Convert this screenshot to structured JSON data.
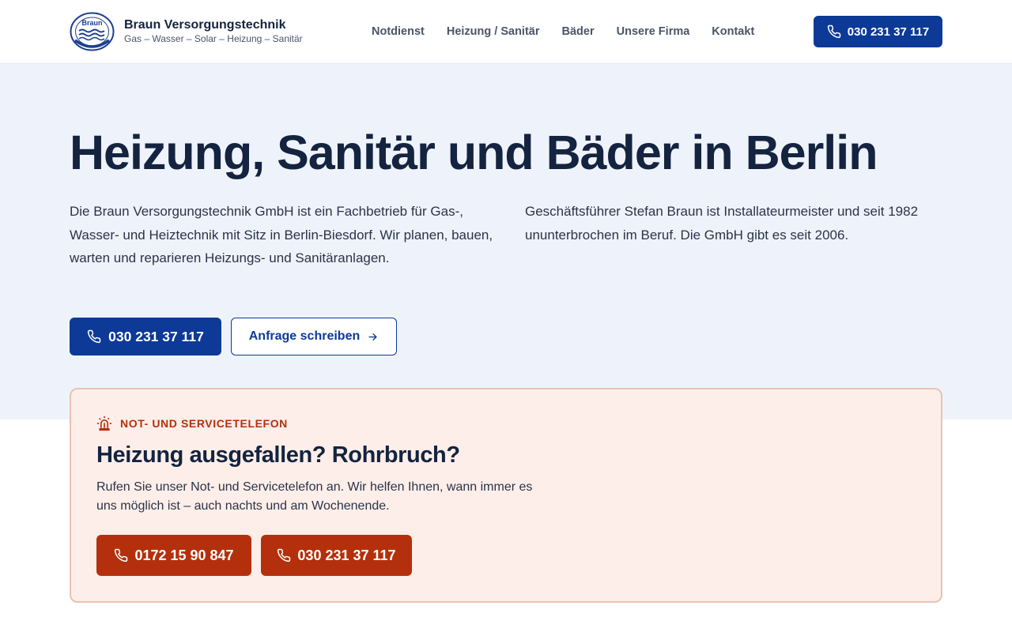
{
  "header": {
    "brand_name": "Braun Versorgungstechnik",
    "brand_tagline": "Gas – Wasser – Solar – Heizung – Sanitär",
    "logo_text": "Braun",
    "nav": [
      {
        "label": "Notdienst"
      },
      {
        "label": "Heizung / Sanitär"
      },
      {
        "label": "Bäder"
      },
      {
        "label": "Unsere Firma"
      },
      {
        "label": "Kontakt"
      }
    ],
    "call_button": "030 231 37 117"
  },
  "hero": {
    "title": "Heizung, Sanitär und Bäder in Berlin",
    "paragraph_left": "Die Braun Versorgungstechnik GmbH ist ein Fachbetrieb für Gas-, Wasser- und Heiztechnik mit Sitz in Berlin-Biesdorf. Wir planen, bauen, warten und reparieren Heizungs- und Sanitäranlagen.",
    "paragraph_right": "Geschäftsführer Stefan Braun ist Installateurmeister und seit 1982 ununterbrochen im Beruf. Die GmbH gibt es seit 2006.",
    "primary_button": "030 231 37 117",
    "secondary_button": "Anfrage schreiben"
  },
  "emergency": {
    "label": "NOT- UND SERVICETELEFON",
    "title": "Heizung ausgefallen? Rohrbruch?",
    "text": "Rufen Sie unser Not- und Servicetelefon an. Wir helfen Ihnen, wann immer es uns möglich ist – auch nachts und am Wochenende.",
    "button_mobile": "0172 15 90 847",
    "button_landline": "030 231 37 117"
  },
  "colors": {
    "primary": "#0c3a96",
    "emergency_accent": "#b4300c",
    "hero_bg": "#eef2fa",
    "emergency_bg": "#fdeee9",
    "heading": "#14233f"
  },
  "icons": [
    "phone-icon",
    "arrow-right-icon",
    "siren-icon",
    "company-logo"
  ]
}
